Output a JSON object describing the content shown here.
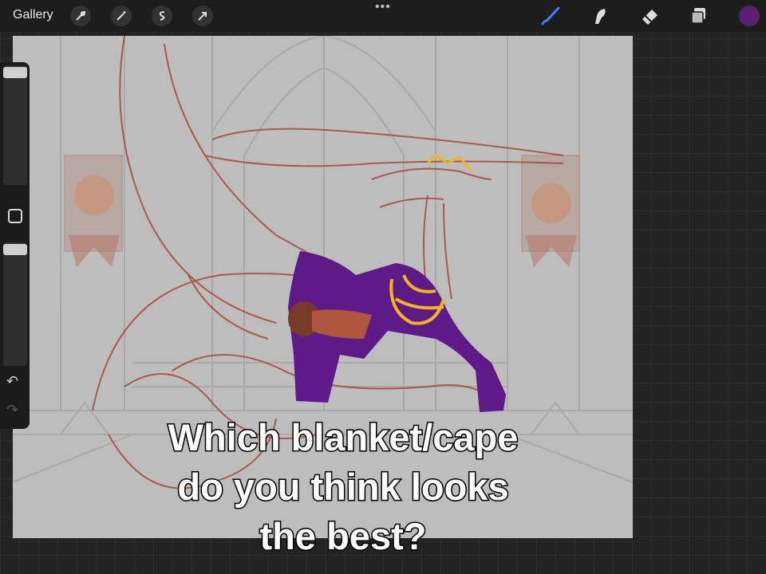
{
  "topbar": {
    "gallery_label": "Gallery",
    "left_tools": [
      "wrench-icon",
      "magic-wand-icon",
      "selection-icon",
      "transform-arrow-icon"
    ],
    "right_tools": [
      "brush-icon",
      "smudge-icon",
      "eraser-icon",
      "layers-icon"
    ],
    "more_dots": "•••",
    "active_color": "#5a1e78",
    "accent": "#3c82f6"
  },
  "sidebar": {
    "undo_symbol": "↶",
    "redo_symbol": "↷"
  },
  "caption": {
    "line1": "Which blanket/cape",
    "line2": "do you think looks",
    "line3": "the best?"
  }
}
